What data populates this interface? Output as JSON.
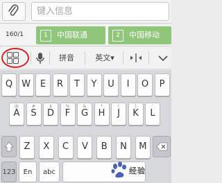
{
  "compose": {
    "placeholder": "键入信息",
    "char_count": "160/1",
    "sim1": {
      "number": "1",
      "label": "中国联通"
    },
    "sim2": {
      "number": "2",
      "label": "中国移动"
    }
  },
  "toolbar": {
    "pinyin_label": "拼音",
    "english_label": "英文▾",
    "cursor_icon": "cursor-move-icon",
    "collapse_icon": "chevron-down-icon"
  },
  "keyboard": {
    "row1": [
      {
        "hint": "",
        "key": "Q"
      },
      {
        "hint": "",
        "key": "W"
      },
      {
        "hint": "",
        "key": "E"
      },
      {
        "hint": "",
        "key": "R"
      },
      {
        "hint": "",
        "key": "T"
      },
      {
        "hint": "",
        "key": "Y"
      },
      {
        "hint": "",
        "key": "U"
      },
      {
        "hint": "",
        "key": "I"
      },
      {
        "hint": "",
        "key": "O"
      },
      {
        "hint": "",
        "key": "P"
      }
    ],
    "row2": [
      {
        "hint": "@",
        "key": "A"
      },
      {
        "hint": "#",
        "key": "S"
      },
      {
        "hint": "$",
        "key": "D"
      },
      {
        "hint": "%",
        "key": "F"
      },
      {
        "hint": "&",
        "key": "G"
      },
      {
        "hint": "*",
        "key": "H"
      },
      {
        "hint": "(",
        "key": "J"
      },
      {
        "hint": ")",
        "key": "K"
      },
      {
        "hint": "'",
        "key": "L"
      }
    ],
    "row3": [
      {
        "hint": "",
        "key": "Z"
      },
      {
        "hint": "",
        "key": "X"
      },
      {
        "hint": "",
        "key": "C"
      },
      {
        "hint": "",
        "key": "V"
      },
      {
        "hint": "",
        "key": "B"
      },
      {
        "hint": "",
        "key": "N"
      },
      {
        "hint": "",
        "key": "M"
      }
    ],
    "bottom": {
      "numeric_label": "123",
      "en_label": "En",
      "abc_label": "abc"
    }
  },
  "watermark": {
    "text": "经验"
  },
  "colors": {
    "sim_button": "#8fc67a",
    "highlight_circle": "#e01e1e",
    "keyboard_bg": "#d7d8dc"
  }
}
